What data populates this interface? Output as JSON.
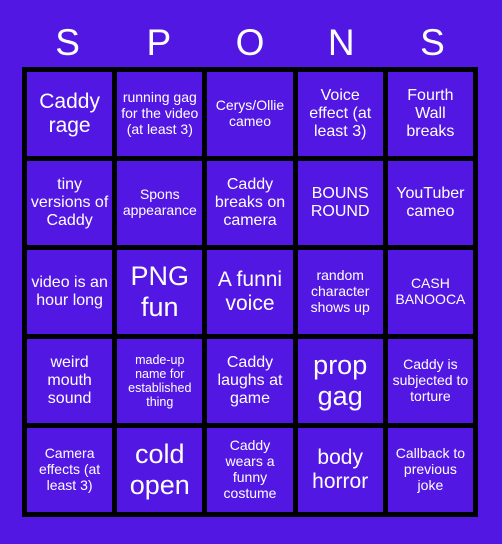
{
  "card": {
    "background_color": "#5317e3",
    "border_color": "#000000",
    "text_color": "#ffffff",
    "header_letters": [
      "S",
      "P",
      "O",
      "N",
      "S"
    ],
    "rows": 5,
    "columns": 5,
    "cells": [
      {
        "text": "Caddy rage",
        "size": "lg"
      },
      {
        "text": "running gag for the video (at least 3)",
        "size": "sm"
      },
      {
        "text": "Cerys/Ollie cameo",
        "size": "sm"
      },
      {
        "text": "Voice effect (at least 3)",
        "size": "md"
      },
      {
        "text": "Fourth Wall breaks",
        "size": "md"
      },
      {
        "text": "tiny versions of Caddy",
        "size": "md"
      },
      {
        "text": "Spons appearance",
        "size": "sm"
      },
      {
        "text": "Caddy breaks on camera",
        "size": "md"
      },
      {
        "text": "BOUNS ROUND",
        "size": "md"
      },
      {
        "text": "YouTuber cameo",
        "size": "md"
      },
      {
        "text": "video is an hour long",
        "size": "md"
      },
      {
        "text": "PNG fun",
        "size": "xl"
      },
      {
        "text": "A funni voice",
        "size": "lg"
      },
      {
        "text": "random character shows up",
        "size": "sm"
      },
      {
        "text": "CASH BANOOCA",
        "size": "sm"
      },
      {
        "text": "weird mouth sound",
        "size": "md"
      },
      {
        "text": "made-up name for established thing",
        "size": "xs"
      },
      {
        "text": "Caddy laughs at game",
        "size": "md"
      },
      {
        "text": "prop gag",
        "size": "xl"
      },
      {
        "text": "Caddy is subjected to torture",
        "size": "sm"
      },
      {
        "text": "Camera effects (at least 3)",
        "size": "sm"
      },
      {
        "text": "cold open",
        "size": "xl"
      },
      {
        "text": "Caddy wears a funny costume",
        "size": "sm"
      },
      {
        "text": "body horror",
        "size": "lg"
      },
      {
        "text": "Callback to previous joke",
        "size": "sm"
      }
    ]
  }
}
